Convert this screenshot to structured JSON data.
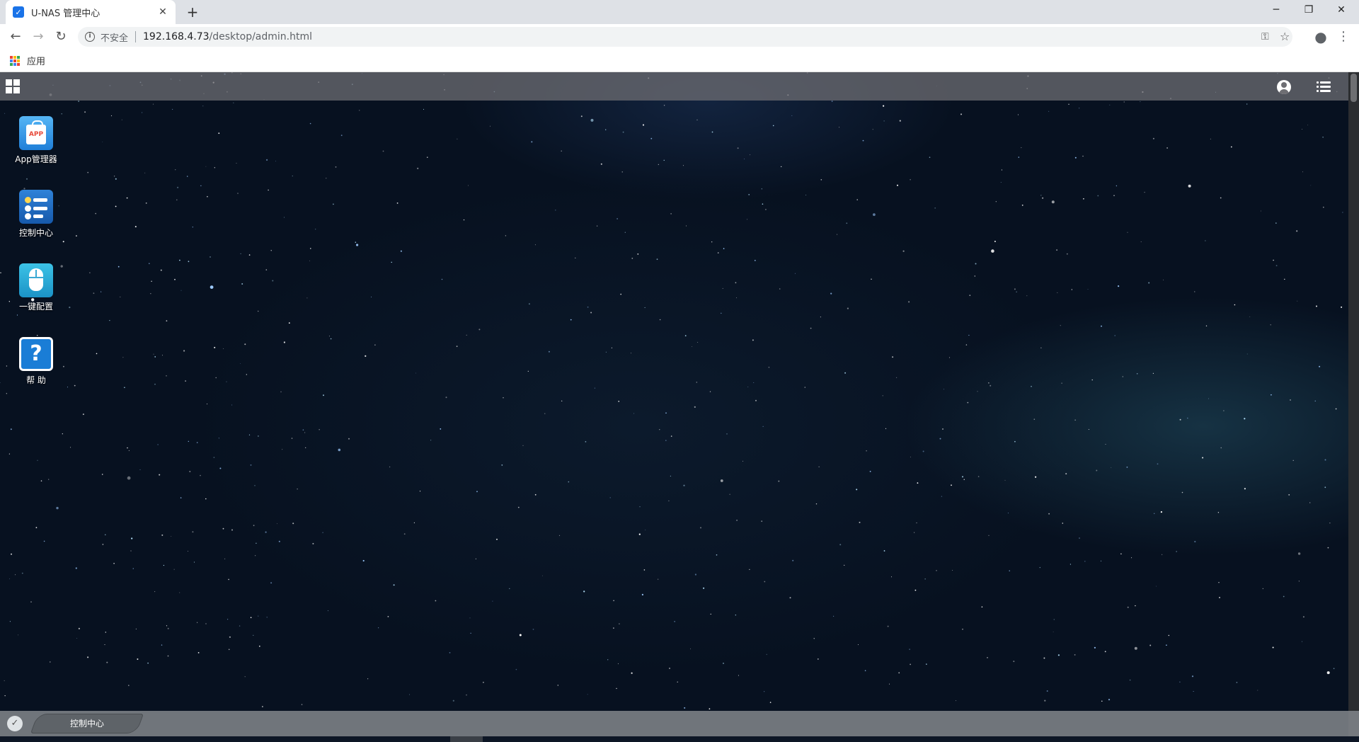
{
  "browser": {
    "tab_title": "U-NAS 管理中心",
    "tab_favicon_glyph": "✓",
    "close_tab_glyph": "✕",
    "new_tab_glyph": "+",
    "window_controls": {
      "minimize": "─",
      "restore": "❐",
      "close": "✕"
    },
    "nav": {
      "back": "←",
      "forward": "→",
      "reload": "↻"
    },
    "address": {
      "security_label": "不安全",
      "host": "192.168.4.73",
      "path": "/desktop/admin.html"
    },
    "omnibox_icons": {
      "key": "⚿",
      "star": "☆",
      "profile": "●",
      "menu": "⋮"
    },
    "bookmarks": {
      "apps_label": "应用",
      "apps_grid_colors": [
        "#ea4335",
        "#fbbc04",
        "#34a853",
        "#4285f4",
        "#ea4335",
        "#fbbc04",
        "#34a853",
        "#4285f4",
        "#ea4335"
      ]
    }
  },
  "desktop": {
    "icons": [
      {
        "name": "app-manager",
        "label": "App管理器",
        "badge": "APP"
      },
      {
        "name": "control-center",
        "label": "控制中心"
      },
      {
        "name": "one-click-setup",
        "label": "一键配置"
      },
      {
        "name": "help",
        "label": "帮 助",
        "glyph": "?"
      }
    ],
    "taskbar": {
      "logo_glyph": "✓",
      "tasks": [
        {
          "label": "控制中心"
        }
      ]
    }
  },
  "colors": {
    "topbar": "#6e6e73",
    "accent": "#1a73e8"
  }
}
